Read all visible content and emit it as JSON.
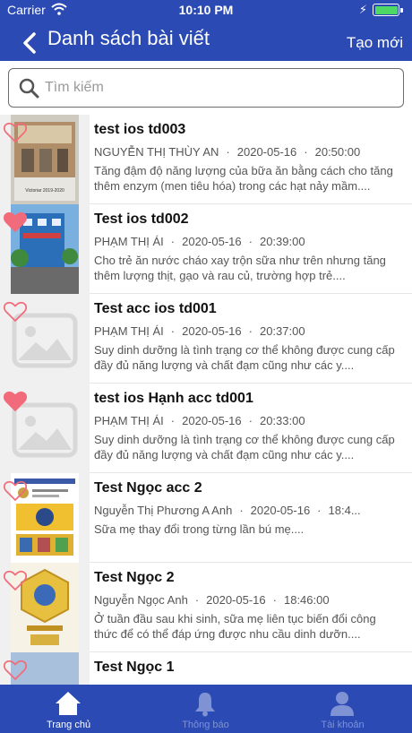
{
  "status_bar": {
    "carrier": "Carrier",
    "time": "10:10 PM"
  },
  "nav": {
    "title": "Danh sách bài viết",
    "action": "Tạo mới"
  },
  "search": {
    "placeholder": "Tìm kiếm",
    "value": ""
  },
  "posts": [
    {
      "title": "test ios td003",
      "author": "NGUYỄN THỊ THÙY AN",
      "date": "2020-05-16",
      "time": "20:50:00",
      "excerpt": "Tăng đậm độ năng lượng của bữa ăn bằng cách cho tăng thêm enzym (men tiêu hóa) trong các hạt nảy mầm....",
      "favorited": false,
      "thumbnail": "building-photo",
      "thumbnail_caption": "Victoriar 2019-2020"
    },
    {
      "title": "Test ios td002",
      "author": "PHẠM THỊ ÁI",
      "date": "2020-05-16",
      "time": "20:39:00",
      "excerpt": "Cho trẻ ăn nước cháo xay trộn sữa như trên nhưng tăng thêm lượng thịt, gạo và rau củ, trường hợp trẻ....",
      "favorited": true,
      "thumbnail": "street-photo"
    },
    {
      "title": "Test acc ios td001",
      "author": "PHẠM THỊ ÁI",
      "date": "2020-05-16",
      "time": "20:37:00",
      "excerpt": "Suy dinh dưỡng là tình trạng cơ thể không được cung cấp đầy đủ năng lượng và chất đạm cũng như các y....",
      "favorited": false,
      "thumbnail": "placeholder-image"
    },
    {
      "title": "test ios Hạnh acc td001",
      "author": "PHẠM THỊ ÁI",
      "date": "2020-05-16",
      "time": "20:33:00",
      "excerpt": "Suy dinh dưỡng là tình trạng cơ thể không được cung cấp đầy đủ năng lượng và chất đạm cũng như các y....",
      "favorited": true,
      "thumbnail": "placeholder-image"
    },
    {
      "title": "Test Ngọc acc 2",
      "author": "Nguyễn Thị Phương A Anh",
      "date": "2020-05-16",
      "time": "18:4...",
      "excerpt": "Sữa mẹ thay đổi trong từng lần bú mẹ....",
      "favorited": false,
      "thumbnail": "app-screenshot"
    },
    {
      "title": "Test Ngọc 2",
      "author": "Nguyễn Ngọc Anh",
      "date": "2020-05-16",
      "time": "18:46:00",
      "excerpt": "Ở tuần đầu sau khi sinh, sữa mẹ liên tục biến đổi công thức để có thể đáp ứng được nhu cầu dinh dưỡn....",
      "favorited": false,
      "thumbnail": "award-certificate"
    },
    {
      "title": "Test Ngọc 1",
      "author": "",
      "date": "",
      "time": "",
      "excerpt": "",
      "favorited": false,
      "thumbnail": "photo"
    }
  ],
  "tabs": [
    {
      "label": "Trang chủ",
      "icon": "home-icon",
      "active": true
    },
    {
      "label": "Thông báo",
      "icon": "bell-icon",
      "active": false
    },
    {
      "label": "Tài khoản",
      "icon": "user-icon",
      "active": false
    }
  ],
  "colors": {
    "primary": "#2b4ab4",
    "heart": "#f26b7a",
    "battery": "#4cd964",
    "tab_inactive": "#7f92d4"
  }
}
